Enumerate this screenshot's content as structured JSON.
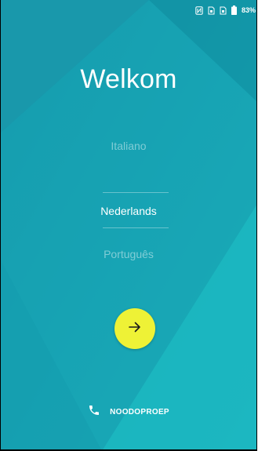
{
  "status_bar": {
    "battery": "83%",
    "icons": [
      "nfc-icon",
      "sim-icon",
      "sim-icon",
      "battery-icon"
    ]
  },
  "welcome": {
    "title": "Welkom"
  },
  "language_picker": {
    "previous": "Italiano",
    "selected": "Nederlands",
    "next": "Português"
  },
  "next_button": {
    "icon": "arrow-right-icon",
    "color": "#eef236"
  },
  "emergency": {
    "label": "NOODOPROEP",
    "icon": "phone-icon"
  },
  "colors": {
    "background": "#1aa8b6",
    "accent": "#eef236"
  }
}
